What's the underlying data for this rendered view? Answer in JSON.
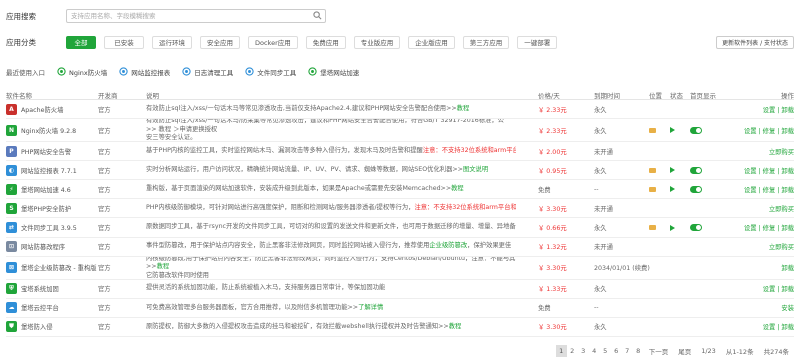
{
  "search": {
    "label": "应用搜索",
    "placeholder": "支持应用名称、字段模糊搜索"
  },
  "categories": {
    "label": "应用分类",
    "items": [
      "全部",
      "已安装",
      "运行环境",
      "安全应用",
      "Docker应用",
      "免费应用",
      "专业版应用",
      "企业版应用",
      "第三方应用",
      "一键部署"
    ],
    "update_label": "更新软件列表 / 支付状态"
  },
  "recent": {
    "label": "最近使用入口",
    "items": [
      "Nginx防火墙",
      "网站监控报表",
      "日志清理工具",
      "文件同步工具",
      "堡塔网站加速"
    ]
  },
  "headers": {
    "name": "软件名称",
    "dev": "开发商",
    "desc": "说明",
    "price": "价格/天",
    "expire": "到期时间",
    "location": "位置",
    "status": "状态",
    "home": "首页显示",
    "op": "操作"
  },
  "colors": {
    "accent": "#20a53a",
    "price_red": "#e33333"
  },
  "rows": [
    {
      "name": "Apache防火墙",
      "icon": "A",
      "icon_color": "#c9302c",
      "dev": "官方",
      "desc": "有效防止sql注入/xss/一句话木马等常见渗透攻击,当前仅支持Apache2.4,建议和PHP网站安全告警配合使用>>",
      "desc_red": "",
      "desc_link": "教程",
      "price": "￥ 2.33元",
      "expire": "永久",
      "folder": false,
      "play": false,
      "toggle": false,
      "ops": "设置 | 卸载",
      "tall": false
    },
    {
      "name": "Nginx防火墙 9.2.8",
      "icon": "N",
      "icon_color": "#20a53a",
      "dev": "官方",
      "desc": "有效防止sql注入/xss/一句话木马/防采集等常见渗透攻击，建议和PHP网站安全告警配合使用，符合GB/T 32917-2016标准，公 >> 教程 ＞申请更换授权",
      "desc_red": "",
      "desc_link": "",
      "desc2": "安三等安全认证。",
      "price": "￥ 2.33元",
      "expire": "永久",
      "folder": true,
      "play": true,
      "toggle": true,
      "ops": "设置 | 修复 | 卸载",
      "tall": true
    },
    {
      "name": "PHP网站安全告警",
      "icon": "P",
      "icon_color": "#5a7abd",
      "dev": "官方",
      "desc": "基于PHP内核的监控工具，实时监控网站木马、漏洞攻击等多种入侵行为，发现木马及时告警和提醒",
      "desc_red": "注意：不支持32位系统和arm平台和PHP5.2>>",
      "desc_link": "教程",
      "price": "￥ 2.00元",
      "expire": "未开通",
      "folder": false,
      "play": false,
      "toggle": false,
      "ops": "立即购买",
      "tall": false
    },
    {
      "name": "网站监控报表 7.7.1",
      "icon": "◐",
      "icon_color": "#2f8fd8",
      "dev": "官方",
      "desc": "实时分析网站运行，用户访问状况，精确统计网站流量、IP、UV、PV、请求、蜘蛛等数据，网站SEO优化利器>>",
      "desc_red": "",
      "desc_link": "图文说明",
      "price": "￥ 0.95元",
      "expire": "永久",
      "folder": true,
      "play": true,
      "toggle": true,
      "ops": "设置 | 修复 | 卸载",
      "tall": false
    },
    {
      "name": "堡塔网站加速 4.6",
      "icon": "⚡",
      "icon_color": "#20a53a",
      "dev": "官方",
      "desc": "重构版，基于页面渲染的网站加速软件，安装成升级到此版本，如果是Apache或需要先安装Memcached>>",
      "desc_red": "",
      "desc_link": "教程",
      "price": "免费",
      "expire": "--",
      "folder": true,
      "play": true,
      "toggle": true,
      "ops": "设置 | 修复 | 卸载",
      "tall": false
    },
    {
      "name": "堡塔PHP安全防护",
      "icon": "S",
      "icon_color": "#20a53a",
      "dev": "官方",
      "desc": "PHP内核级防御模块，可针对网站进行高强度保护，阻断和检测网站/服务器渗透者/提权等行为，",
      "desc_red": "注意：不支持32位系统和arm平台和PHP5.2>>",
      "desc_link": "教程",
      "price": "￥ 3.30元",
      "expire": "未开通",
      "folder": false,
      "play": false,
      "toggle": false,
      "ops": "立即购买",
      "tall": false
    },
    {
      "name": "文件同步工具 3.9.5",
      "icon": "⇄",
      "icon_color": "#2f8fd8",
      "dev": "官方",
      "desc": "原数据同步工具，基于rsync开发的文件同步工具，可切对的和设置的发送文件和更新文件，也可用于数据迁移的增量、增量、异地备份等场景>>",
      "desc_red": "",
      "desc_link": "教程",
      "price": "￥ 0.66元",
      "expire": "永久",
      "folder": true,
      "play": true,
      "toggle": true,
      "ops": "设置 | 修复 | 卸载",
      "tall": false
    },
    {
      "name": "网站防篡改程序",
      "icon": "⊡",
      "icon_color": "#7a8aa0",
      "dev": "官方",
      "desc": "事件型防篡改，用于保护站点内容安全，防止黑客非法修改网页，同时监控网站被入侵行为，推荐使用",
      "desc_red": "",
      "desc_link": "企业级防篡改",
      "desc_after": "，保护效果更佳",
      "price": "￥ 1.32元",
      "expire": "未开通",
      "folder": false,
      "play": false,
      "toggle": false,
      "ops": "立即购买",
      "tall": false
    },
    {
      "name": "堡塔企业级防篡改 - 重构版",
      "icon": "⊠",
      "icon_color": "#2f8fd8",
      "dev": "官方",
      "desc": "内核级防篡改,用于保护站点内容安全，防止黑客非法修改网页，同时监控入侵行为，支持Centos/Debian/Ubuntu，注意：不能与其 >>",
      "desc_red": "",
      "desc_link": "教程",
      "desc2": "它防篡改软件同时使用",
      "price": "￥ 3.30元",
      "expire": "2034/01/01 (续费)",
      "folder": false,
      "play": false,
      "toggle": false,
      "ops": "卸载",
      "tall": true
    },
    {
      "name": "宝塔系统加固",
      "icon": "⛨",
      "icon_color": "#20a53a",
      "dev": "官方",
      "desc": "提供灵活的系统加固功能，防止系统被植入木马，支持服务器日常审计，等保加固功能",
      "desc_red": "",
      "desc_link": "",
      "price": "￥ 1.33元",
      "expire": "永久",
      "folder": false,
      "play": false,
      "toggle": false,
      "ops": "设置 | 卸载",
      "tall": false
    },
    {
      "name": "堡塔云控平台",
      "icon": "☁",
      "icon_color": "#2f8fd8",
      "dev": "官方",
      "desc": "可免费高效管理多台服务器面板，官方合用推荐，以及附信多机管理功能>>",
      "desc_red": "",
      "desc_link": "了解详情",
      "price": "免费",
      "expire": "--",
      "folder": false,
      "play": false,
      "toggle": false,
      "ops": "安装",
      "tall": false
    },
    {
      "name": "堡塔防入侵",
      "icon": "⛊",
      "icon_color": "#20a53a",
      "dev": "官方",
      "desc": "原防提权，防御大多数的入侵提权攻击造成的挂马和被挖矿，有效拦截webshell执行提权并及时告警通知>>",
      "desc_red": "",
      "desc_link": "教程",
      "price": "￥ 3.30元",
      "expire": "永久",
      "folder": false,
      "play": false,
      "toggle": false,
      "ops": "设置 | 卸载",
      "tall": false
    }
  ],
  "pager": {
    "pages": [
      "1",
      "2",
      "3",
      "4",
      "5",
      "6",
      "7",
      "8"
    ],
    "next": "下一页",
    "last": "尾页",
    "page_info": "1/23",
    "range": "从1-12条",
    "total": "共274条"
  }
}
